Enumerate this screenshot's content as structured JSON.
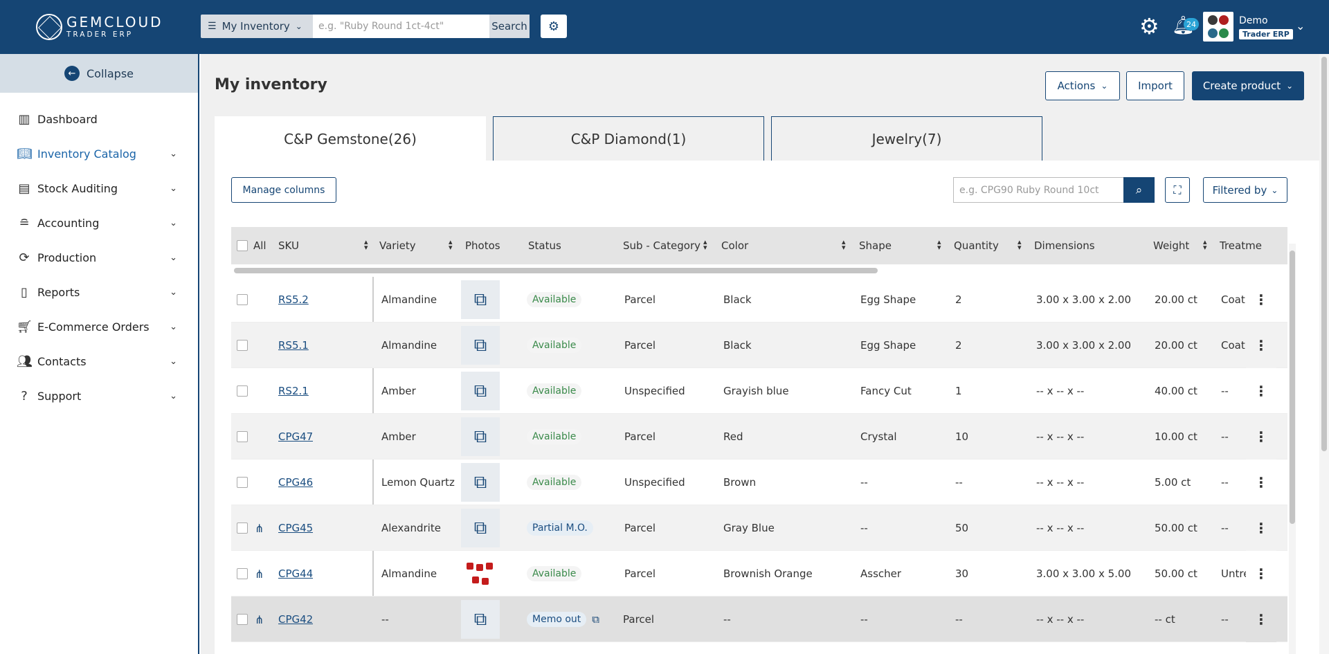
{
  "header": {
    "logo_name": "GEMCLOUD",
    "logo_sub": "TRADER ERP",
    "scope_label": "My Inventory",
    "search_placeholder": "e.g. \"Ruby Round 1ct-4ct\"",
    "search_button": "Search",
    "notification_count": "24",
    "user_name": "Demo",
    "user_role": "Trader ERP"
  },
  "sidebar": {
    "collapse_label": "Collapse",
    "items": [
      {
        "label": "Dashboard",
        "icon": "chart-icon"
      },
      {
        "label": "Inventory Catalog",
        "icon": "book-icon"
      },
      {
        "label": "Stock Auditing",
        "icon": "clipboard-icon"
      },
      {
        "label": "Accounting",
        "icon": "coins-icon"
      },
      {
        "label": "Production",
        "icon": "refresh-icon"
      },
      {
        "label": "Reports",
        "icon": "report-icon"
      },
      {
        "label": "E-Commerce Orders",
        "icon": "cart-icon"
      },
      {
        "label": "Contacts",
        "icon": "users-icon"
      },
      {
        "label": "Support",
        "icon": "help-icon"
      }
    ]
  },
  "page": {
    "title": "My inventory",
    "actions_label": "Actions",
    "import_label": "Import",
    "create_label": "Create product"
  },
  "tabs": [
    {
      "label": "C&P Gemstone(26)"
    },
    {
      "label": "C&P Diamond(1)"
    },
    {
      "label": "Jewelry(7)"
    }
  ],
  "toolbar": {
    "manage_columns": "Manage columns",
    "search_placeholder": "e.g. CPG90 Ruby Round 10ct",
    "filter_label": "Filtered by"
  },
  "columns": {
    "all": "All",
    "sku": "SKU",
    "variety": "Variety",
    "photos": "Photos",
    "status": "Status",
    "subcategory": "Sub - Category",
    "color": "Color",
    "shape": "Shape",
    "quantity": "Quantity",
    "dimensions": "Dimensions",
    "weight": "Weight",
    "treatment": "Treatme"
  },
  "rows": [
    {
      "sku": "RS5.2",
      "variety": "Almandine",
      "status": "Available",
      "subcategory": "Parcel",
      "color": "Black",
      "shape": "Egg Shape",
      "quantity": "2",
      "dimensions": "3.00 x 3.00 x 2.00",
      "weight": "20.00  ct",
      "treatment": "Coati"
    },
    {
      "sku": "RS5.1",
      "variety": "Almandine",
      "status": "Available",
      "subcategory": "Parcel",
      "color": "Black",
      "shape": "Egg Shape",
      "quantity": "2",
      "dimensions": "3.00 x 3.00 x 2.00",
      "weight": "20.00  ct",
      "treatment": "Coati"
    },
    {
      "sku": "RS2.1",
      "variety": "Amber",
      "status": "Available",
      "subcategory": "Unspecified",
      "color": "Grayish blue",
      "shape": "Fancy Cut",
      "quantity": "1",
      "dimensions": "--  x --  x --",
      "weight": "40.00  ct",
      "treatment": "--"
    },
    {
      "sku": "CPG47",
      "variety": "Amber",
      "status": "Available",
      "subcategory": "Parcel",
      "color": "Red",
      "shape": "Crystal",
      "quantity": "10",
      "dimensions": "--  x --  x --",
      "weight": "10.00  ct",
      "treatment": "--"
    },
    {
      "sku": "CPG46",
      "variety": "Lemon Quartz",
      "status": "Available",
      "subcategory": "Unspecified",
      "color": "Brown",
      "shape": "--",
      "quantity": "--",
      "dimensions": "--  x --  x --",
      "weight": "5.00  ct",
      "treatment": "--"
    },
    {
      "sku": "CPG45",
      "variety": "Alexandrite",
      "status": "Partial M.O.",
      "subcategory": "Parcel",
      "color": "Gray Blue",
      "shape": "--",
      "quantity": "50",
      "dimensions": "--  x --  x --",
      "weight": "50.00  ct",
      "treatment": "--"
    },
    {
      "sku": "CPG44",
      "variety": "Almandine",
      "status": "Available",
      "subcategory": "Parcel",
      "color": "Brownish Orange",
      "shape": "Asscher",
      "quantity": "30",
      "dimensions": "3.00 x 3.00 x 5.00",
      "weight": "50.00  ct",
      "treatment": "Untre"
    },
    {
      "sku": "CPG42",
      "variety": "--",
      "status": "Memo out",
      "subcategory": "Parcel",
      "color": "--",
      "shape": "--",
      "quantity": "--",
      "dimensions": "--  x --  x --",
      "weight": "--   ct",
      "treatment": "--"
    }
  ]
}
